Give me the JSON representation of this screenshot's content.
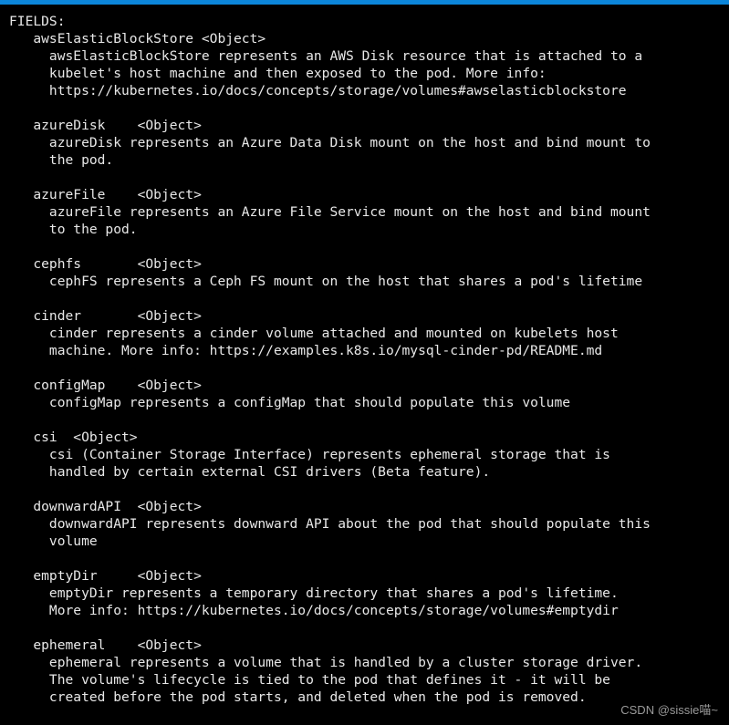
{
  "window": {
    "title_bar_color": "#0c86da",
    "background_color": "#000000",
    "text_color": "#e8e8e8"
  },
  "terminal": {
    "section_header": "FIELDS:",
    "fields": [
      {
        "name": "awsElasticBlockStore",
        "type": "<Object>",
        "header_line": "   awsElasticBlockStore <Object>",
        "description_lines": [
          "     awsElasticBlockStore represents an AWS Disk resource that is attached to a",
          "     kubelet's host machine and then exposed to the pod. More info:",
          "     https://kubernetes.io/docs/concepts/storage/volumes#awselasticblockstore"
        ]
      },
      {
        "name": "azureDisk",
        "type": "<Object>",
        "header_line": "   azureDisk    <Object>",
        "description_lines": [
          "     azureDisk represents an Azure Data Disk mount on the host and bind mount to",
          "     the pod."
        ]
      },
      {
        "name": "azureFile",
        "type": "<Object>",
        "header_line": "   azureFile    <Object>",
        "description_lines": [
          "     azureFile represents an Azure File Service mount on the host and bind mount",
          "     to the pod."
        ]
      },
      {
        "name": "cephfs",
        "type": "<Object>",
        "header_line": "   cephfs       <Object>",
        "description_lines": [
          "     cephFS represents a Ceph FS mount on the host that shares a pod's lifetime"
        ]
      },
      {
        "name": "cinder",
        "type": "<Object>",
        "header_line": "   cinder       <Object>",
        "description_lines": [
          "     cinder represents a cinder volume attached and mounted on kubelets host",
          "     machine. More info: https://examples.k8s.io/mysql-cinder-pd/README.md"
        ]
      },
      {
        "name": "configMap",
        "type": "<Object>",
        "header_line": "   configMap    <Object>",
        "description_lines": [
          "     configMap represents a configMap that should populate this volume"
        ]
      },
      {
        "name": "csi",
        "type": "<Object>",
        "header_line": "   csi  <Object>",
        "description_lines": [
          "     csi (Container Storage Interface) represents ephemeral storage that is",
          "     handled by certain external CSI drivers (Beta feature)."
        ]
      },
      {
        "name": "downwardAPI",
        "type": "<Object>",
        "header_line": "   downwardAPI  <Object>",
        "description_lines": [
          "     downwardAPI represents downward API about the pod that should populate this",
          "     volume"
        ]
      },
      {
        "name": "emptyDir",
        "type": "<Object>",
        "header_line": "   emptyDir     <Object>",
        "description_lines": [
          "     emptyDir represents a temporary directory that shares a pod's lifetime.",
          "     More info: https://kubernetes.io/docs/concepts/storage/volumes#emptydir"
        ]
      },
      {
        "name": "ephemeral",
        "type": "<Object>",
        "header_line": "   ephemeral    <Object>",
        "description_lines": [
          "     ephemeral represents a volume that is handled by a cluster storage driver.",
          "     The volume's lifecycle is tied to the pod that defines it - it will be",
          "     created before the pod starts, and deleted when the pod is removed."
        ]
      }
    ],
    "full_text": "FIELDS:\n   awsElasticBlockStore <Object>\n     awsElasticBlockStore represents an AWS Disk resource that is attached to a\n     kubelet's host machine and then exposed to the pod. More info:\n     https://kubernetes.io/docs/concepts/storage/volumes#awselasticblockstore\n\n   azureDisk    <Object>\n     azureDisk represents an Azure Data Disk mount on the host and bind mount to\n     the pod.\n\n   azureFile    <Object>\n     azureFile represents an Azure File Service mount on the host and bind mount\n     to the pod.\n\n   cephfs       <Object>\n     cephFS represents a Ceph FS mount on the host that shares a pod's lifetime\n\n   cinder       <Object>\n     cinder represents a cinder volume attached and mounted on kubelets host\n     machine. More info: https://examples.k8s.io/mysql-cinder-pd/README.md\n\n   configMap    <Object>\n     configMap represents a configMap that should populate this volume\n\n   csi  <Object>\n     csi (Container Storage Interface) represents ephemeral storage that is\n     handled by certain external CSI drivers (Beta feature).\n\n   downwardAPI  <Object>\n     downwardAPI represents downward API about the pod that should populate this\n     volume\n\n   emptyDir     <Object>\n     emptyDir represents a temporary directory that shares a pod's lifetime.\n     More info: https://kubernetes.io/docs/concepts/storage/volumes#emptydir\n\n   ephemeral    <Object>\n     ephemeral represents a volume that is handled by a cluster storage driver.\n     The volume's lifecycle is tied to the pod that defines it - it will be\n     created before the pod starts, and deleted when the pod is removed."
  },
  "watermark": {
    "text": "CSDN @sissie喵~"
  }
}
